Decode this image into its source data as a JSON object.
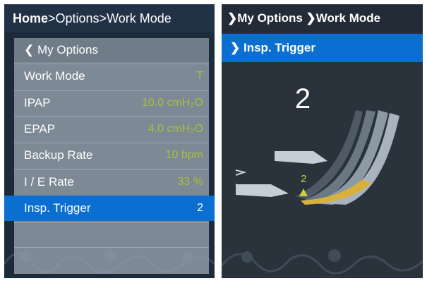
{
  "left": {
    "breadcrumb": {
      "home": "Home",
      "rest": ">Options>Work Mode"
    },
    "menu": {
      "back_label": "My Options",
      "items": [
        {
          "label": "Work Mode",
          "value": "T"
        },
        {
          "label": "IPAP",
          "value": "10.0 cmH₂O"
        },
        {
          "label": "EPAP",
          "value": "4.0 cmH₂O"
        },
        {
          "label": "Backup Rate",
          "value": "10 bpm"
        },
        {
          "label": "I / E Rate",
          "value": "33 %"
        },
        {
          "label": "Insp. Trigger",
          "value": "2"
        }
      ]
    }
  },
  "right": {
    "breadcrumb": {
      "part1": "My Options",
      "part2": "Work Mode"
    },
    "sub_header": "Insp. Trigger",
    "big_value": "2",
    "gauge_marker_value": "2",
    "gauge_level": 2,
    "colors": {
      "accent": "#0a6fd1",
      "fill": "#d8b13a",
      "marker": "#c8d040"
    }
  }
}
